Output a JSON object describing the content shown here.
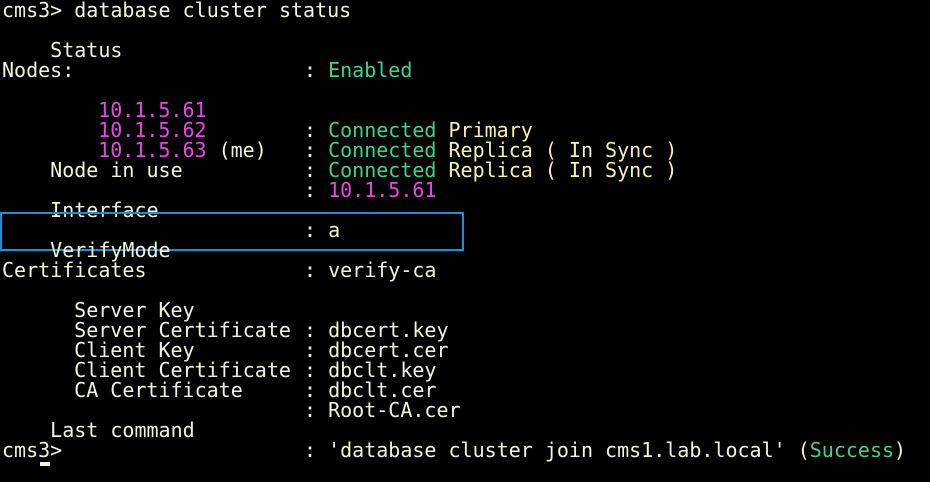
{
  "command_line": "cms3> database cluster status",
  "status": {
    "label": "Status",
    "value": "Enabled"
  },
  "nodes_header": "Nodes:",
  "nodes": [
    {
      "ip": "10.1.5.61",
      "suffix": "",
      "state": "Connected",
      "role": "Primary"
    },
    {
      "ip": "10.1.5.62",
      "suffix": "",
      "state": "Connected",
      "role": "Replica ( In Sync )"
    },
    {
      "ip": "10.1.5.63",
      "suffix": " (me)",
      "state": "Connected",
      "role": "Replica ( In Sync )"
    }
  ],
  "node_in_use": {
    "label": "Node in use",
    "value": "10.1.5.61"
  },
  "interface": {
    "label": "Interface",
    "value": "a"
  },
  "verify_mode": {
    "label": "VerifyMode",
    "value": "verify-ca"
  },
  "certificates": {
    "header": "Certificates",
    "items": [
      {
        "label": "Server Key",
        "value": "dbcert.key"
      },
      {
        "label": "Server Certificate",
        "value": "dbcert.cer"
      },
      {
        "label": "Client Key",
        "value": "dbclt.key"
      },
      {
        "label": "Client Certificate",
        "value": "dbclt.cer"
      },
      {
        "label": "CA Certificate",
        "value": "Root-CA.cer"
      }
    ]
  },
  "last_command": {
    "label": "Last command",
    "value": "'database cluster join cms1.lab.local' (",
    "result": "Success",
    "close": ")"
  },
  "prompt": "cms3>",
  "separator": ": ",
  "colors": {
    "background": "#000000",
    "text": "#f4f4dc",
    "status_green": "#3fd48a",
    "ip_magenta": "#e846e6",
    "role_yellow": "#f7f3a8",
    "highlight_border": "#1d8fd6"
  }
}
